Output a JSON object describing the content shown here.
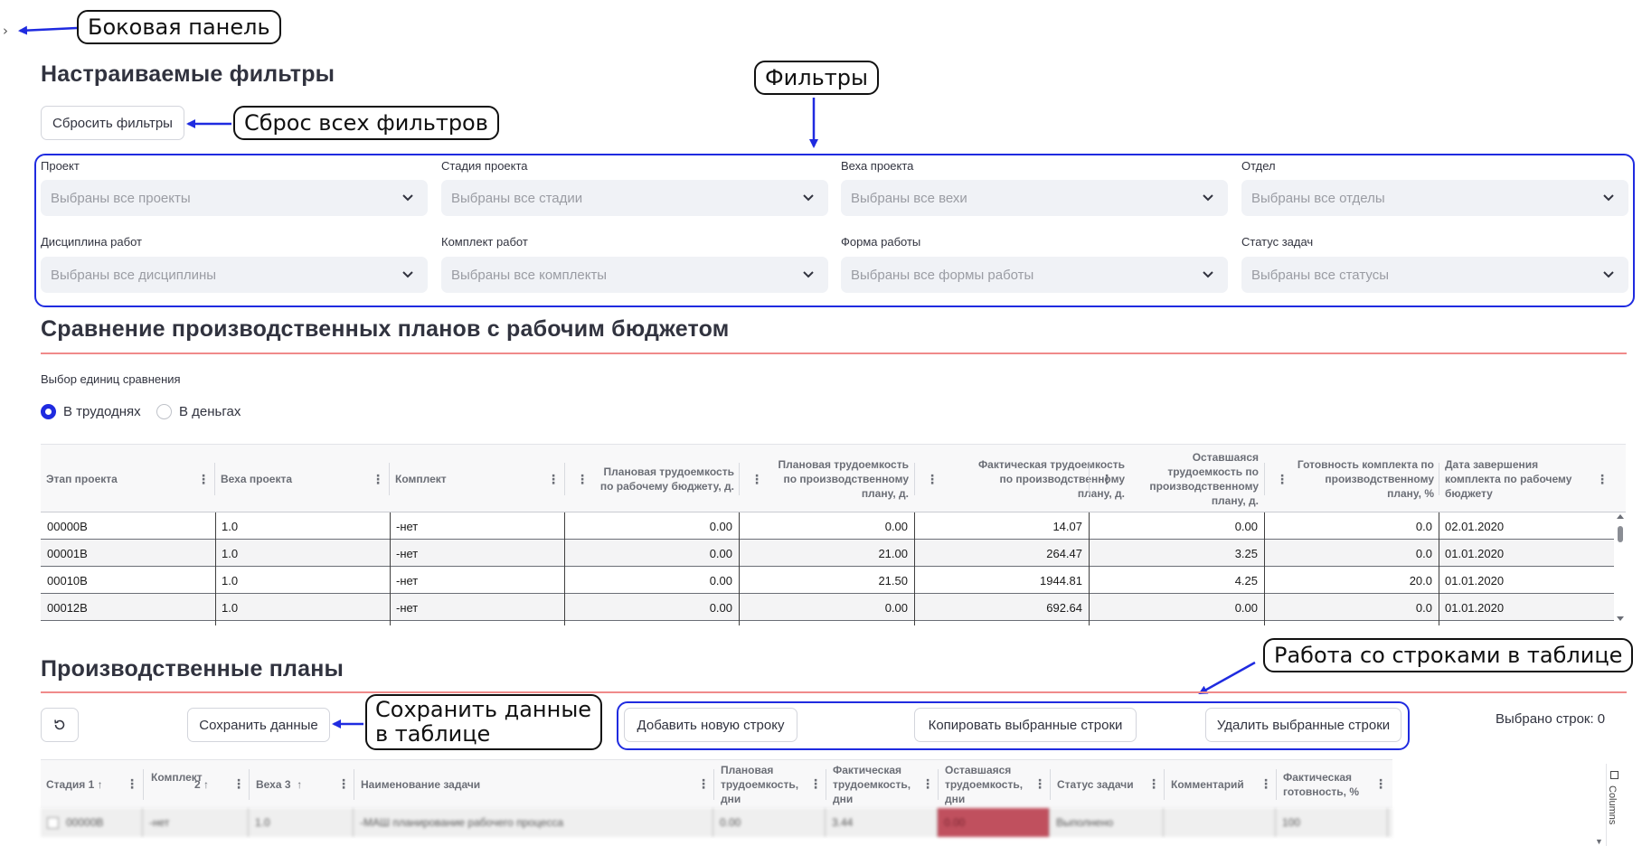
{
  "callouts": {
    "sidebar": "Боковая панель",
    "reset": "Сброс всех фильтров",
    "filters": "Фильтры",
    "save": "Сохранить данные в таблице",
    "rows": "Работа со строками в таблице"
  },
  "filters_section": {
    "title": "Настраиваемые фильтры",
    "reset_button": "Сбросить фильтры",
    "filters": [
      {
        "label": "Проект",
        "value": "Выбраны все проекты"
      },
      {
        "label": "Стадия проекта",
        "value": "Выбраны все стадии"
      },
      {
        "label": "Веха проекта",
        "value": "Выбраны все вехи"
      },
      {
        "label": "Отдел",
        "value": "Выбраны все отделы"
      },
      {
        "label": "Дисциплина работ",
        "value": "Выбраны все дисциплины"
      },
      {
        "label": "Комплект работ",
        "value": "Выбраны все комплекты"
      },
      {
        "label": "Форма работы",
        "value": "Выбраны все формы работы"
      },
      {
        "label": "Статус задач",
        "value": "Выбраны все статусы"
      }
    ]
  },
  "comparison": {
    "title": "Сравнение производственных планов с рабочим бюджетом",
    "units_label": "Выбор единиц сравнения",
    "options": [
      "В трудоднях",
      "В деньгах"
    ],
    "selected": 0,
    "columns": [
      "Этап проекта",
      "Веха проекта",
      "Комплект",
      "Плановая трудоемкость по рабочему бюджету, д.",
      "Плановая трудоемкость по производственному плану, д.",
      "Фактическая трудоемкость по производственному плану, д.",
      "Оставшаяся трудоемкость по производственному плану, д.",
      "Готовность комплекта по производственному плану, %",
      "Дата завершения комплекта по рабочему бюджету"
    ],
    "rows": [
      [
        "00000B",
        "1.0",
        "-нет",
        "0.00",
        "0.00",
        "14.07",
        "0.00",
        "0.0",
        "02.01.2020"
      ],
      [
        "00001B",
        "1.0",
        "-нет",
        "0.00",
        "21.00",
        "264.47",
        "3.25",
        "0.0",
        "01.01.2020"
      ],
      [
        "00010B",
        "1.0",
        "-нет",
        "0.00",
        "21.50",
        "1944.81",
        "4.25",
        "20.0",
        "01.01.2020"
      ],
      [
        "00012B",
        "1.0",
        "-нет",
        "0.00",
        "0.00",
        "692.64",
        "0.00",
        "0.0",
        "01.01.2020"
      ]
    ]
  },
  "plans": {
    "title": "Производственные планы",
    "save_button": "Сохранить данные",
    "add_button": "Добавить новую строку",
    "copy_button": "Копировать выбранные строки",
    "delete_button": "Удалить выбранные строки",
    "selected_count": "Выбрано строк: 0",
    "columns_panel": "Columns",
    "columns": [
      {
        "label": "Стадия",
        "sort": "1"
      },
      {
        "label": "Комплект",
        "sort": "2"
      },
      {
        "label": "Веха",
        "sort": "3"
      },
      {
        "label": "Наименование задачи",
        "sort": ""
      },
      {
        "label": "Плановая трудоемкость, дни",
        "sort": ""
      },
      {
        "label": "Фактическая трудоемкость, дни",
        "sort": ""
      },
      {
        "label": "Оставшаяся трудоемкость, дни",
        "sort": ""
      },
      {
        "label": "Статус задачи",
        "sort": ""
      },
      {
        "label": "Комментарий",
        "sort": ""
      },
      {
        "label": "Фактическая готовность, %",
        "sort": ""
      }
    ],
    "row": [
      "00000B",
      "-нет",
      "1.0",
      "-МАШ планирование рабочего процесса",
      "0.00",
      "3.44",
      "0.00",
      "Выполнено",
      "",
      "100"
    ],
    "remaining_cell_color": "#c0505e"
  },
  "colors": {
    "accent": "#1f2be0",
    "divider": "#f08a8a"
  }
}
